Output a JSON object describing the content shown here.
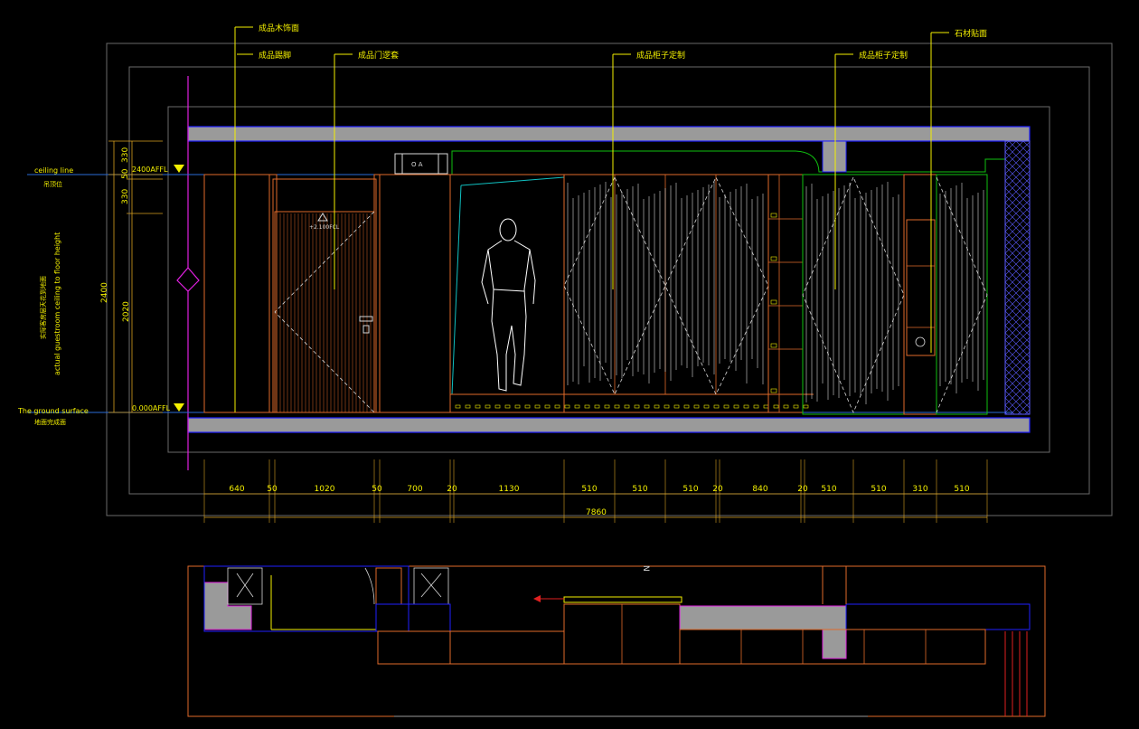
{
  "callouts": [
    {
      "label": "成品木饰面"
    },
    {
      "label": "成品踢脚"
    },
    {
      "label": "成品门逻套"
    },
    {
      "label": "成品柜子定制"
    },
    {
      "label": "成品柜子定制"
    },
    {
      "label": "石材贴面"
    }
  ],
  "levels": {
    "ceiling_line_en": "ceiling line",
    "ceiling_line_cn": "吊顶位",
    "ceiling_affl": "2400AFFL",
    "ground_en": "The ground surface",
    "ground_cn": "地面完成面",
    "ground_affl": "0.000AFFL"
  },
  "side_note": {
    "cn": "实际客房层天花到地面",
    "en": "actual guestroom ceiling to floor height"
  },
  "vertical_dims": {
    "total": "2400",
    "door_height": "2020",
    "top": [
      "330",
      "50",
      "330"
    ]
  },
  "horizontal_dims": [
    "640",
    "50",
    "1020",
    "50",
    "700",
    "20",
    "1130",
    "510",
    "510",
    "510",
    "20",
    "840",
    "20",
    "510",
    "510",
    "310",
    "510"
  ],
  "total_width": "7860",
  "tags": {
    "ac": "O A",
    "door_level": "+2.100FCL"
  },
  "plan_mark": "N"
}
